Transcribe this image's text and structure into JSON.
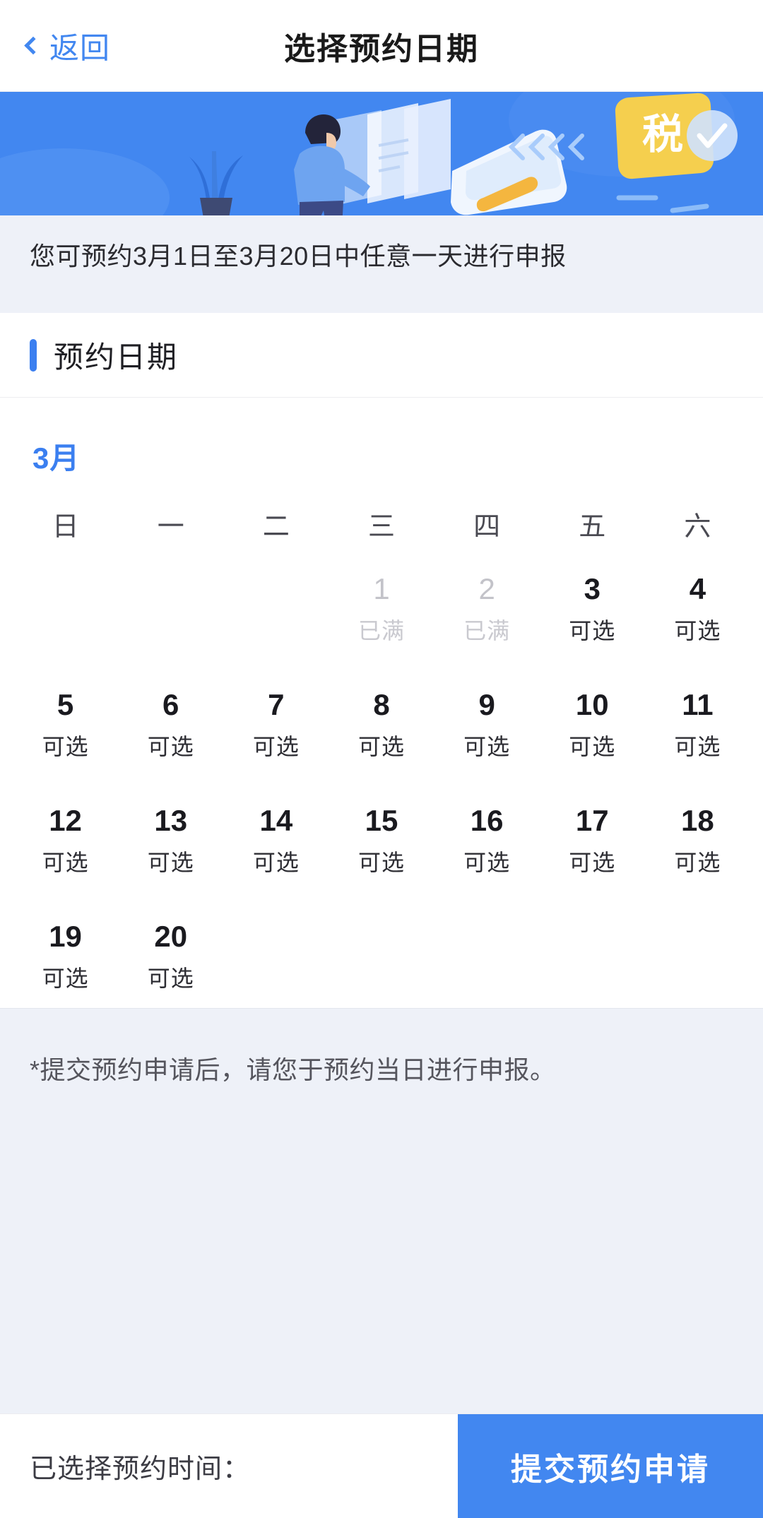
{
  "navbar": {
    "back_label": "返回",
    "back_icon": "chevron-left-icon",
    "title": "选择预约日期"
  },
  "banner": {
    "badge_text": "税",
    "chevron_decor": "<<<<",
    "background_color": "#4287f0",
    "badge_color": "#f5cf4e"
  },
  "notice": {
    "text": "您可预约3月1日至3月20日中任意一天进行申报"
  },
  "section": {
    "title": "预约日期",
    "accent_color": "#3b7ff0"
  },
  "calendar": {
    "month_label": "3月",
    "month_color": "#3b7ff0",
    "weekdays": [
      "日",
      "一",
      "二",
      "三",
      "四",
      "五",
      "六"
    ],
    "leading_blanks": 3,
    "days": [
      {
        "num": "1",
        "state": "已满",
        "available": false
      },
      {
        "num": "2",
        "state": "已满",
        "available": false
      },
      {
        "num": "3",
        "state": "可选",
        "available": true
      },
      {
        "num": "4",
        "state": "可选",
        "available": true
      },
      {
        "num": "5",
        "state": "可选",
        "available": true
      },
      {
        "num": "6",
        "state": "可选",
        "available": true
      },
      {
        "num": "7",
        "state": "可选",
        "available": true
      },
      {
        "num": "8",
        "state": "可选",
        "available": true
      },
      {
        "num": "9",
        "state": "可选",
        "available": true
      },
      {
        "num": "10",
        "state": "可选",
        "available": true
      },
      {
        "num": "11",
        "state": "可选",
        "available": true
      },
      {
        "num": "12",
        "state": "可选",
        "available": true
      },
      {
        "num": "13",
        "state": "可选",
        "available": true
      },
      {
        "num": "14",
        "state": "可选",
        "available": true
      },
      {
        "num": "15",
        "state": "可选",
        "available": true
      },
      {
        "num": "16",
        "state": "可选",
        "available": true
      },
      {
        "num": "17",
        "state": "可选",
        "available": true
      },
      {
        "num": "18",
        "state": "可选",
        "available": true
      },
      {
        "num": "19",
        "state": "可选",
        "available": true
      },
      {
        "num": "20",
        "state": "可选",
        "available": true
      }
    ]
  },
  "footnote": {
    "text": "*提交预约申请后，请您于预约当日进行申报。"
  },
  "bottom": {
    "selected_label": "已选择预约时间：",
    "selected_value": "",
    "submit_label": "提交预约申请",
    "submit_color": "#4287f0"
  }
}
